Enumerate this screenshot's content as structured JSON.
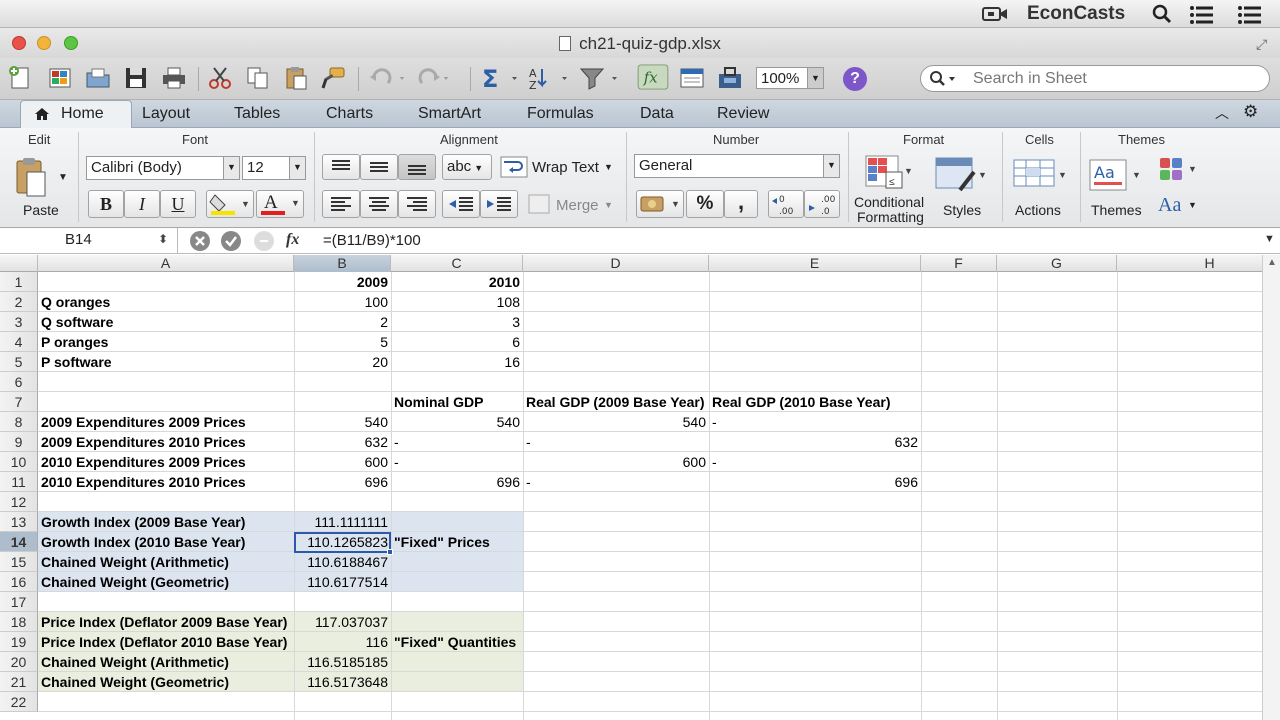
{
  "menubar": {
    "brand": "EconCasts"
  },
  "window": {
    "title": "ch21-quiz-gdp.xlsx"
  },
  "toolbar": {
    "zoom": "100%",
    "help": "?",
    "search_placeholder": "Search in Sheet"
  },
  "ribbon_tabs": [
    "Home",
    "Layout",
    "Tables",
    "Charts",
    "SmartArt",
    "Formulas",
    "Data",
    "Review"
  ],
  "ribbon": {
    "groups": {
      "edit": "Edit",
      "font": "Font",
      "alignment": "Alignment",
      "number": "Number",
      "format": "Format",
      "cells": "Cells",
      "themes": "Themes"
    },
    "paste": "Paste",
    "font_name": "Calibri (Body)",
    "font_size": "12",
    "bold": "B",
    "italic": "I",
    "underline": "U",
    "font_color": "A",
    "abc": "abc",
    "wrap_text": "Wrap Text",
    "merge": "Merge",
    "number_format": "General",
    "percent": "%",
    "comma": ",",
    "conditional_formatting_1": "Conditional",
    "conditional_formatting_2": "Formatting",
    "styles": "Styles",
    "actions": "Actions",
    "themes": "Themes",
    "aa": "Aa"
  },
  "formula_bar": {
    "cell_ref": "B14",
    "fx": "fx",
    "formula": "=(B11/B9)*100"
  },
  "columns": [
    "A",
    "B",
    "C",
    "D",
    "E",
    "F",
    "G",
    "H"
  ],
  "rows": [
    "1",
    "2",
    "3",
    "4",
    "5",
    "6",
    "7",
    "8",
    "9",
    "10",
    "11",
    "12",
    "13",
    "14",
    "15",
    "16",
    "17",
    "18",
    "19",
    "20",
    "21",
    "22"
  ],
  "cells": {
    "r1": {
      "b": "2009",
      "c": "2010"
    },
    "r2": {
      "a": "Q oranges",
      "b": "100",
      "c": "108"
    },
    "r3": {
      "a": "Q software",
      "b": "2",
      "c": "3"
    },
    "r4": {
      "a": "P oranges",
      "b": "5",
      "c": "6"
    },
    "r5": {
      "a": "P software",
      "b": "20",
      "c": "16"
    },
    "r7": {
      "c": "Nominal GDP",
      "d": "Real GDP (2009 Base Year)",
      "e": "Real GDP (2010 Base Year)"
    },
    "r8": {
      "a": "2009 Expenditures 2009 Prices",
      "b": "540",
      "c": "540",
      "d": "540",
      "e": "-"
    },
    "r9": {
      "a": "2009 Expenditures 2010 Prices",
      "b": "632",
      "c": "-",
      "d": "-",
      "e": "632"
    },
    "r10": {
      "a": "2010 Expenditures 2009 Prices",
      "b": "600",
      "c": "-",
      "d": "600",
      "e": "-"
    },
    "r11": {
      "a": "2010 Expenditures 2010 Prices",
      "b": "696",
      "c": "696",
      "d": "-",
      "e": "696"
    },
    "r13": {
      "a": "Growth Index (2009 Base Year)",
      "b": "111.1111111"
    },
    "r14": {
      "a": "Growth Index (2010 Base Year)",
      "b": "110.1265823",
      "c": "\"Fixed\" Prices"
    },
    "r15": {
      "a": "Chained Weight (Arithmetic)",
      "b": "110.6188467"
    },
    "r16": {
      "a": "Chained Weight (Geometric)",
      "b": "110.6177514"
    },
    "r18": {
      "a": "Price Index (Deflator 2009 Base Year)",
      "b": "117.037037"
    },
    "r19": {
      "a": "Price Index (Deflator 2010 Base Year)",
      "b": "116",
      "c": "\"Fixed\" Quantities"
    },
    "r20": {
      "a": "Chained Weight (Arithmetic)",
      "b": "116.5185185"
    },
    "r21": {
      "a": "Chained Weight (Geometric)",
      "b": "116.5173648"
    }
  },
  "colors": {
    "blue_fill": "#dbe4ef",
    "green_fill": "#e9eedf",
    "selection": "#2c59a8"
  }
}
